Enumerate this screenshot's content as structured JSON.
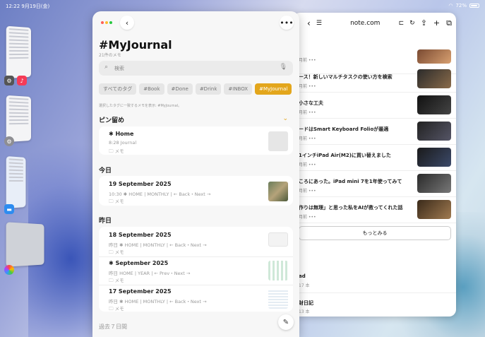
{
  "status_bar": {
    "time": "12:22",
    "date": "9月19日(金)",
    "battery": "72%"
  },
  "bear": {
    "title": "#MyJournal",
    "subtitle": "21件のメモ",
    "search_placeholder": "検索",
    "tags": [
      "すべてのタグ",
      "#Book",
      "#Done",
      "#Drink",
      "#INBOX",
      "#MyJournal"
    ],
    "active_tag": "#MyJournal",
    "hint": "選択したタグに一致するメモを表示: #MyJournal。",
    "sections": {
      "pinned": "ピン留め",
      "today": "今日",
      "yesterday": "昨日",
      "past7": "過去７日間"
    },
    "pinned_notes": [
      {
        "title": "✱ Home",
        "meta": "8:28  Journal",
        "folder": "🗀 メモ"
      }
    ],
    "today_notes": [
      {
        "title": "19 September 2025",
        "meta": "10:30  ✱ HOME | MONTHLY | ← Back・Next →",
        "folder": "🗀 メモ"
      }
    ],
    "yesterday_notes": [
      {
        "title": "18 September 2025",
        "meta": "昨日  ✱ HOME | MONTHLY | ← Back・Next →",
        "folder": "🗀 メモ"
      },
      {
        "title": "✱ September 2025",
        "meta": "昨日  HOME | YEAR | ← Prev・Next →",
        "folder": "🗀 メモ"
      },
      {
        "title": "17 September 2025",
        "meta": "昨日  ✱ HOME | MONTHLY | ← Back・Next →",
        "folder": "🗀 メモ"
      }
    ]
  },
  "safari": {
    "url": "note.com",
    "articles": [
      {
        "title": "",
        "meta": "月前  •••"
      },
      {
        "title": "ース！新しいマルチタスクの使い方を検索",
        "meta": "月前  •••"
      },
      {
        "title": "小さな工夫",
        "meta": "月前  •••"
      },
      {
        "title": "ードはSmart Keyboard Folioが最適",
        "meta": "月前  •••"
      },
      {
        "title": "1インチiPad Air(M2)に買い替えました",
        "meta": "月前  •••"
      },
      {
        "title": "ころにあった。iPad mini 7を1年使ってみて",
        "meta": "月前  •••"
      },
      {
        "title": "作りは無理」と思った私をAIが救ってくれた話",
        "meta": "月前  •••"
      }
    ],
    "more_label": "もっとみる",
    "bottom_items": [
      {
        "title": "ad",
        "meta": "17 本"
      },
      {
        "title": "財日記",
        "meta": "13 本"
      }
    ]
  }
}
